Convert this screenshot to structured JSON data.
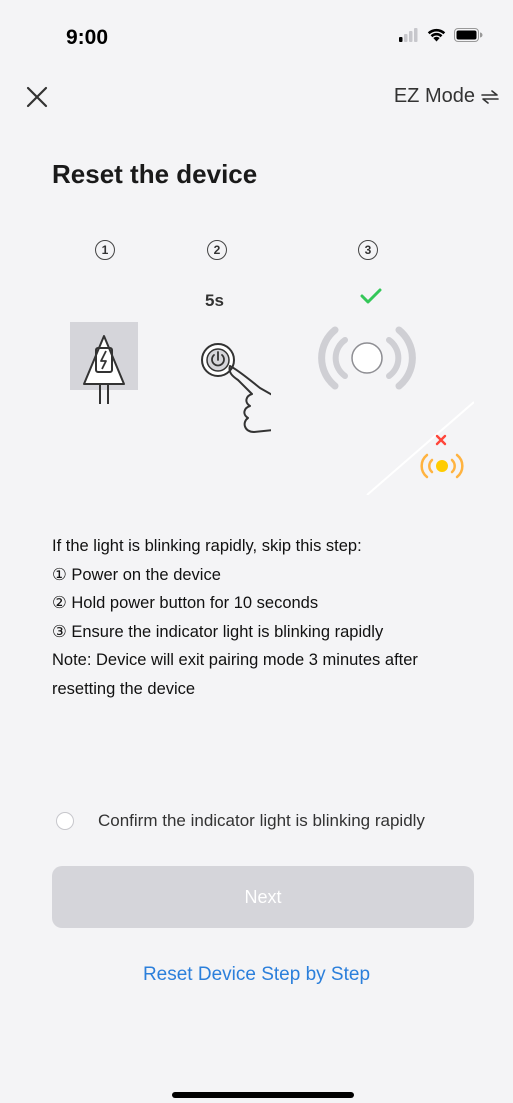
{
  "status_bar": {
    "time": "9:00"
  },
  "header": {
    "mode_label": "EZ Mode",
    "mode_icon": "swap-arrows-icon",
    "close_icon": "close-icon"
  },
  "page": {
    "title": "Reset the device"
  },
  "illustration": {
    "steps": [
      {
        "number": "1",
        "icon": "power-plug-icon"
      },
      {
        "number": "2",
        "duration": "5s",
        "icon": "finger-press-power-button-icon"
      },
      {
        "number": "3",
        "icon": "blinking-light-icon"
      }
    ]
  },
  "instructions": {
    "intro": "If the light is blinking rapidly, skip this step:",
    "steps": [
      "① Power on the device",
      "② Hold power button for 10 seconds",
      "③ Ensure the indicator light is blinking rapidly"
    ],
    "note": "Note: Device will exit pairing mode 3 minutes after resetting the device"
  },
  "confirm": {
    "label": "Confirm the indicator light is blinking rapidly",
    "checked": false
  },
  "buttons": {
    "next": "Next",
    "reset_link": "Reset Device Step by Step"
  },
  "colors": {
    "link": "#2b7fdb",
    "disabled_button": "#d5d5da",
    "success": "#34c759",
    "error": "#ff453a",
    "indicator": "#ffcc00"
  }
}
